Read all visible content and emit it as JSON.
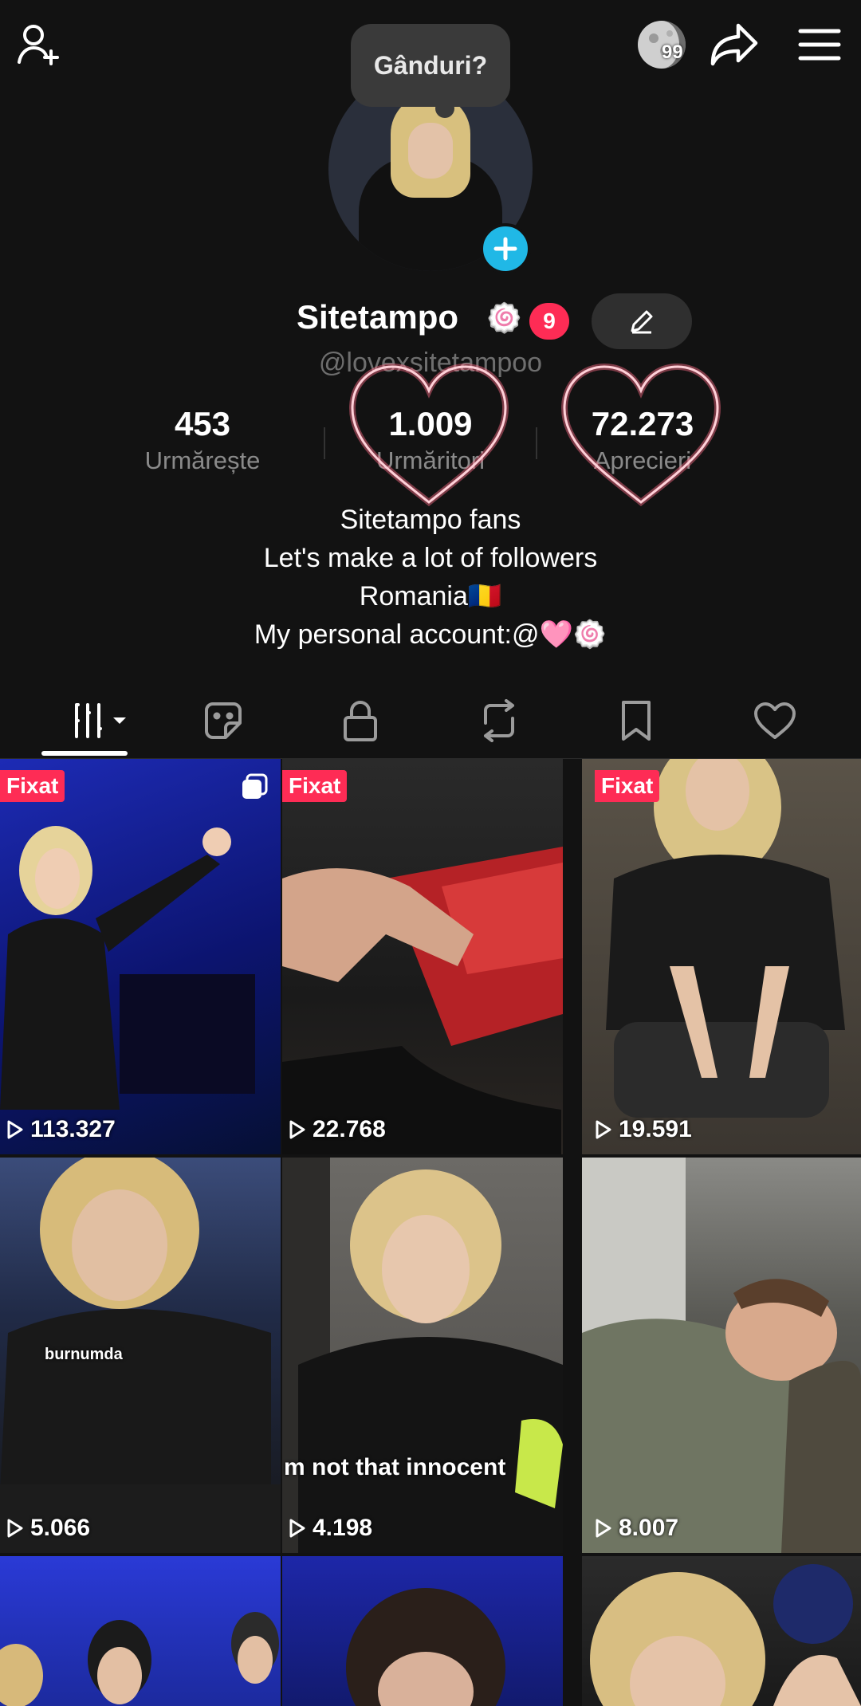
{
  "header": {
    "thought_bubble": "Gânduri?",
    "moon_badge": "99"
  },
  "profile": {
    "username": "Sitetampo",
    "name_emoji": "🍥",
    "notification_count": "9",
    "handle": "@lovexsitetampoo"
  },
  "stats": [
    {
      "value": "453",
      "label": "Urmărește"
    },
    {
      "value": "1.009",
      "label": "Urmăritori"
    },
    {
      "value": "72.273",
      "label": "Aprecieri"
    }
  ],
  "bio": {
    "line1": "Sitetampo fans",
    "line2": "Let's make a lot of followers",
    "line3": "Romania🇷🇴",
    "line4": "My personal account:@🩷🍥"
  },
  "tabs": [
    "videos-icon",
    "sticker-icon",
    "lock-icon",
    "repost-icon",
    "bookmark-icon",
    "heart-icon"
  ],
  "videos": [
    {
      "pinned": "Fixat",
      "views": "113.327"
    },
    {
      "pinned": "Fixat",
      "views": "22.768"
    },
    {
      "pinned": "Fixat",
      "views": "19.591"
    },
    {
      "views": "5.066",
      "caption": "burnumda"
    },
    {
      "views": "4.198",
      "caption": "m not that innocent"
    },
    {
      "views": "8.007"
    },
    {},
    {},
    {}
  ],
  "colors": {
    "background": "#121212",
    "accent_red": "#fe2c55",
    "accent_blue": "#20b8e6",
    "muted_text": "#8a8a8a",
    "heart_glow": "#ff9fb0"
  }
}
